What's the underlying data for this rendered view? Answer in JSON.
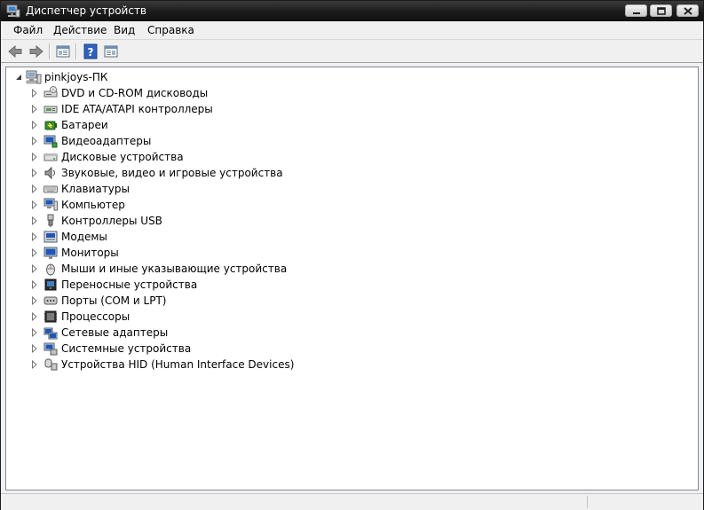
{
  "window": {
    "title": "Диспетчер устройств",
    "controls": [
      "minimize-button",
      "maximize-button",
      "close-button"
    ]
  },
  "menu": {
    "items": [
      "Файл",
      "Действие",
      "Вид",
      "Справка"
    ]
  },
  "toolbar": {
    "buttons": [
      "back-icon",
      "forward-icon",
      "properties-pane-icon",
      "help-icon",
      "scan-hardware-icon"
    ]
  },
  "tree": {
    "root": {
      "label": "pinkjoys-ПК",
      "icon": "computer-icon",
      "expanded": true
    },
    "children": [
      {
        "label": "DVD и CD-ROM дисководы",
        "icon": "dvd-drive-icon"
      },
      {
        "label": "IDE ATA/ATAPI контроллеры",
        "icon": "ide-controller-icon"
      },
      {
        "label": "Батареи",
        "icon": "battery-icon"
      },
      {
        "label": "Видеоадаптеры",
        "icon": "display-adapter-icon"
      },
      {
        "label": "Дисковые устройства",
        "icon": "disk-drive-icon"
      },
      {
        "label": "Звуковые, видео и игровые устройства",
        "icon": "sound-icon"
      },
      {
        "label": "Клавиатуры",
        "icon": "keyboard-icon"
      },
      {
        "label": "Компьютер",
        "icon": "computer-icon"
      },
      {
        "label": "Контроллеры USB",
        "icon": "usb-icon"
      },
      {
        "label": "Модемы",
        "icon": "modem-icon"
      },
      {
        "label": "Мониторы",
        "icon": "monitor-icon"
      },
      {
        "label": "Мыши и иные указывающие устройства",
        "icon": "mouse-icon"
      },
      {
        "label": "Переносные устройства",
        "icon": "portable-device-icon"
      },
      {
        "label": "Порты (COM и LPT)",
        "icon": "port-icon"
      },
      {
        "label": "Процессоры",
        "icon": "processor-icon"
      },
      {
        "label": "Сетевые адаптеры",
        "icon": "network-adapter-icon"
      },
      {
        "label": "Системные устройства",
        "icon": "system-device-icon"
      },
      {
        "label": "Устройства HID (Human Interface Devices)",
        "icon": "hid-icon"
      }
    ]
  },
  "colors": {
    "titlebar": "#1c1c1c",
    "tree_background": "#ffffff",
    "chrome": "#f0f0f0"
  }
}
